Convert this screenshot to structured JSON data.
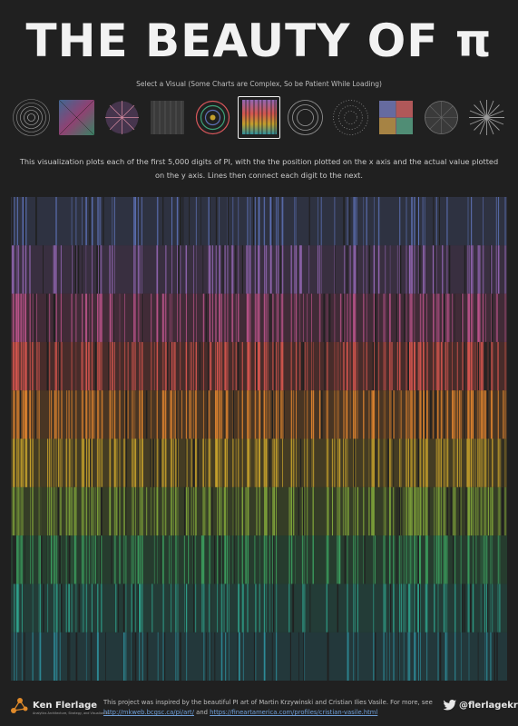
{
  "title": "THE BEAUTY OF π",
  "prompt": "Select a Visual (Some Charts are Complex, So be Patient While Loading)",
  "thumbnails": [
    {
      "icon": "concentric-circles-icon"
    },
    {
      "icon": "spectrum-square-icon"
    },
    {
      "icon": "radial-burst-icon"
    },
    {
      "icon": "grid-lines-icon"
    },
    {
      "icon": "colored-rings-icon"
    },
    {
      "icon": "vertical-lines-icon",
      "selected": true
    },
    {
      "icon": "ring-circles-icon"
    },
    {
      "icon": "dotted-circles-icon"
    },
    {
      "icon": "colored-grid-icon"
    },
    {
      "icon": "wheel-icon"
    },
    {
      "icon": "starburst-icon"
    }
  ],
  "description": "This visualization plots each of the first 5,000 digits of PI, with the the position plotted on the x axis and the actual value plotted on the y axis. Lines then connect each digit to the next.",
  "chart_data": {
    "type": "line",
    "digit_count": 5000,
    "digit_levels": [
      0,
      1,
      2,
      3,
      4,
      5,
      6,
      7,
      8,
      9
    ],
    "level_colors": [
      "#2e8f9c",
      "#2fa08a",
      "#3c9e5e",
      "#7ea23a",
      "#c39f2c",
      "#d9812f",
      "#d4564f",
      "#b85389",
      "#9266b2",
      "#5e72b8"
    ],
    "grid": false
  },
  "footer": {
    "author": "Ken Flerlage",
    "tagline": "Analytics Architecture, Strategy, and Visualization",
    "credit_pre": "This project was inspired by the beautiful PI art of Martin Krzywinski and Cristian Ilies Vasile. For more, see",
    "link1": "http://mkweb.bcgsc.ca/pi/art/",
    "and": "and",
    "link2": "https://fineartamerica.com/profiles/cristian-vasile.html",
    "twitter": "@flerlagekr"
  }
}
